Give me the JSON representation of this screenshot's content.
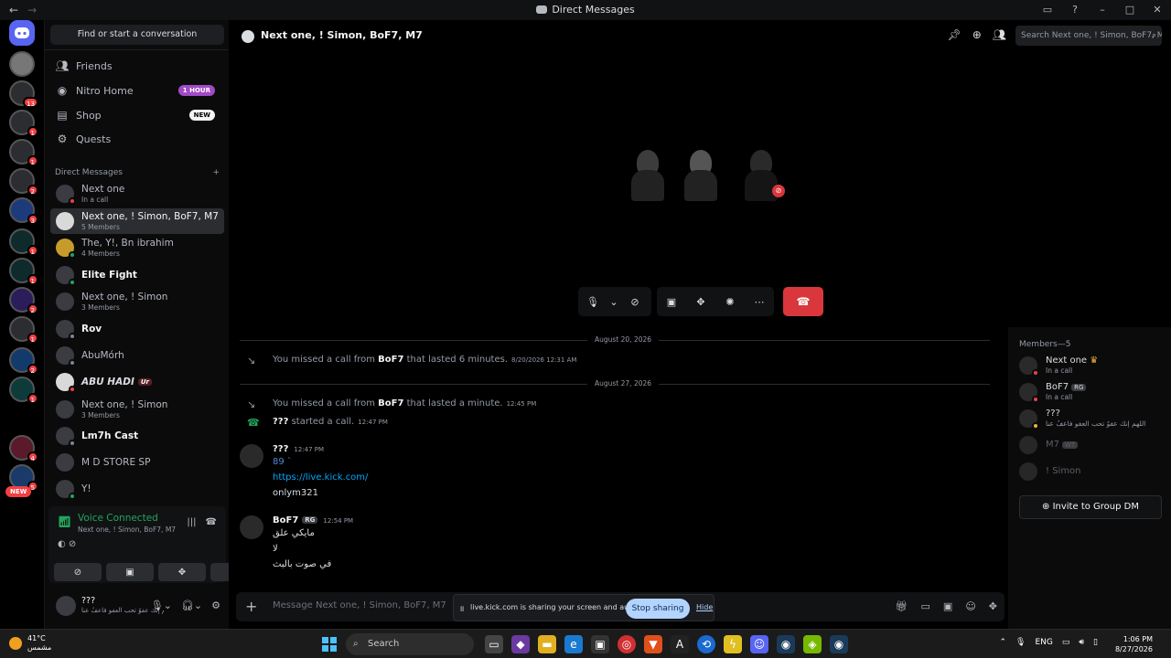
{
  "window": {
    "title": "Direct Messages"
  },
  "servers": [
    {
      "badge": ""
    },
    {
      "badge": "13"
    },
    {
      "badge": "1"
    },
    {
      "badge": "1"
    },
    {
      "badge": "2"
    },
    {
      "badge": "3"
    },
    {
      "badge": "1"
    },
    {
      "badge": "1"
    },
    {
      "badge": "2"
    },
    {
      "badge": "1"
    },
    {
      "badge": "2"
    },
    {
      "badge": "1"
    },
    {
      "badge": "4"
    },
    {
      "badge": "5"
    }
  ],
  "rail": {
    "new_badge": "NEW"
  },
  "sidebar": {
    "find_placeholder": "Find or start a conversation",
    "nav": [
      {
        "label": "Friends",
        "tag": ""
      },
      {
        "label": "Nitro Home",
        "tag": "1 HOUR"
      },
      {
        "label": "Shop",
        "tag": "NEW"
      },
      {
        "label": "Quests",
        "tag": ""
      }
    ],
    "dm_header": "Direct Messages",
    "dms": [
      {
        "name": "Next one",
        "sub": "In a call"
      },
      {
        "name": "Next one, ! Simon, BoF7, M7",
        "sub": "5 Members"
      },
      {
        "name": "The, Y!, Bn ibrahim",
        "sub": "4 Members"
      },
      {
        "name": "Elite Fight",
        "sub": ""
      },
      {
        "name": "Next one, ! Simon",
        "sub": "3 Members"
      },
      {
        "name": "Rov",
        "sub": ""
      },
      {
        "name": "AbuMórh",
        "sub": ""
      },
      {
        "name": "ABU HADI",
        "sub": "",
        "chip": "Ur"
      },
      {
        "name": "Next one, ! Simon",
        "sub": "3 Members"
      },
      {
        "name": "Lm7h Cast",
        "sub": ""
      },
      {
        "name": "M D STORE SP",
        "sub": ""
      },
      {
        "name": "Y!",
        "sub": ""
      }
    ],
    "voice": {
      "status": "Voice Connected",
      "channel": "Next one, ! Simon, BoF7, M7"
    },
    "user": {
      "name": "???",
      "status": "اللهم إنك عفوٌ تحب العفو فاعفُ عنا"
    }
  },
  "header": {
    "channel_name": "Next one, ! Simon, BoF7, M7",
    "search_placeholder": "Search Next one, ! Simon, BoF7, M7"
  },
  "chat": {
    "dividers": [
      "August 20, 2026",
      "August 27, 2026"
    ],
    "system": [
      {
        "pre": "You missed a call from ",
        "who": "BoF7",
        "post": " that lasted 6 minutes.",
        "ts": "8/20/2026 12:31 AM"
      },
      {
        "pre": "You missed a call from ",
        "who": "BoF7",
        "post": " that lasted a minute.",
        "ts": "12:45 PM"
      },
      {
        "pre": "",
        "who": "???",
        "post": " started a call.",
        "ts": "12:47 PM"
      }
    ],
    "messages": [
      {
        "author": "???",
        "ts": "12:47 PM",
        "lines": [
          "89 `",
          "https://live.kick.com/",
          "onlym321"
        ]
      },
      {
        "author": "BoF7",
        "badge": "RG",
        "ts": "12:54 PM",
        "lines": [
          "مايكي علق",
          "لا",
          "في صوت بالبث"
        ]
      }
    ],
    "composer_placeholder": "Message Next one, ! Simon, BoF7, M7"
  },
  "share": {
    "text": "live.kick.com is sharing your screen and audio.",
    "stop_label": "Stop sharing",
    "hide_label": "Hide"
  },
  "members": {
    "header": "Members—5",
    "list": [
      {
        "name": "Next one",
        "sub": "In a call",
        "badge": ""
      },
      {
        "name": "BoF7",
        "sub": "In a call",
        "badge": "RG"
      },
      {
        "name": "???",
        "sub": "اللهم إنك عفوٌ تحب العفو فاعفُ عنا",
        "badge": ""
      },
      {
        "name": "M7",
        "sub": "",
        "badge": "WT"
      },
      {
        "name": "! Simon",
        "sub": "",
        "badge": ""
      }
    ],
    "invite_label": "Invite to Group DM"
  },
  "taskbar": {
    "temp": "41°C",
    "weather": "مشمس",
    "search_label": "Search",
    "lang": "ENG",
    "time": "1:06 PM",
    "date": "8/27/2026"
  }
}
